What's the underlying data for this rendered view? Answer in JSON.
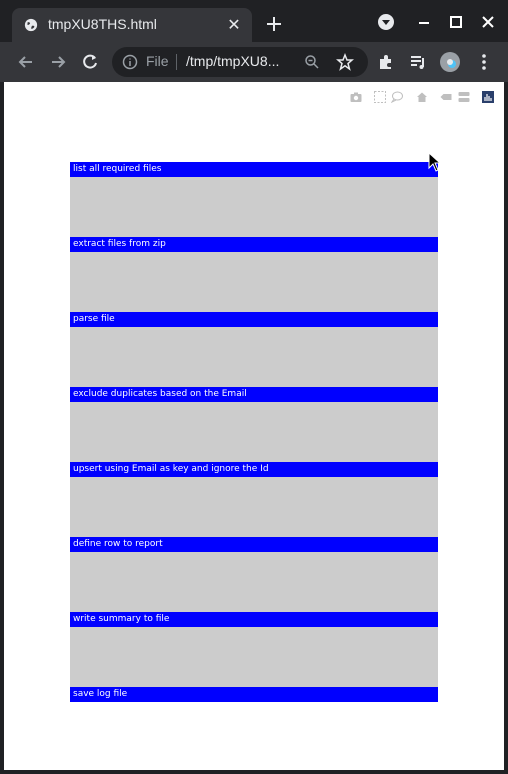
{
  "browser": {
    "tab_title": "tmpXU8THS.html",
    "omnibox_scheme": "File",
    "omnibox_url": "/tmp/tmpXU8..."
  },
  "page_toolbar_icons": [
    "camera-icon",
    "selection-icon",
    "comment-icon",
    "home-icon",
    "label-icon",
    "stack-icon",
    "chart-icon"
  ],
  "flow": {
    "steps": [
      "list all required files",
      "extract files from zip",
      "parse file",
      "exclude duplicates based on the Email",
      "upsert using Email as key and ignore the Id",
      "define row to report",
      "write summary to file",
      "save log file"
    ],
    "colors": {
      "header": "#0000ff",
      "body": "#cccccc",
      "header_text": "#ffffff"
    }
  }
}
